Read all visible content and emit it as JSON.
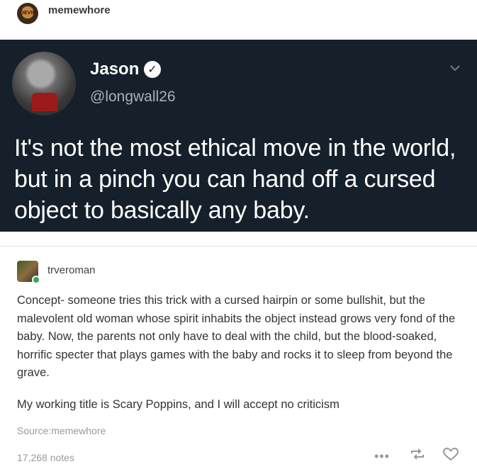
{
  "poster": {
    "name": "memewhore",
    "avatar_text": "DEVIL"
  },
  "tweet": {
    "display_name": "Jason",
    "verified_glyph": "✓",
    "handle": "@longwall26",
    "text": "It's not the most ethical move in the world, but in a pinch you can hand off a cursed object to basically any baby.",
    "background_color": "#15202b"
  },
  "reblog": {
    "name": "trveroman",
    "body": "Concept- someone tries this trick with a cursed hairpin or some bullshit, but the malevolent old woman whose spirit inhabits the object instead grows very fond of the baby. Now, the parents not only have to deal with the child, but the blood-soaked, horrific specter that plays games with the baby and rocks it to sleep from beyond the grave.",
    "working_title": "My working title is Scary Poppins, and I will accept no criticism",
    "source": "Source:memewhore"
  },
  "footer": {
    "notes": "17,268 notes",
    "more_glyph": "•••"
  }
}
